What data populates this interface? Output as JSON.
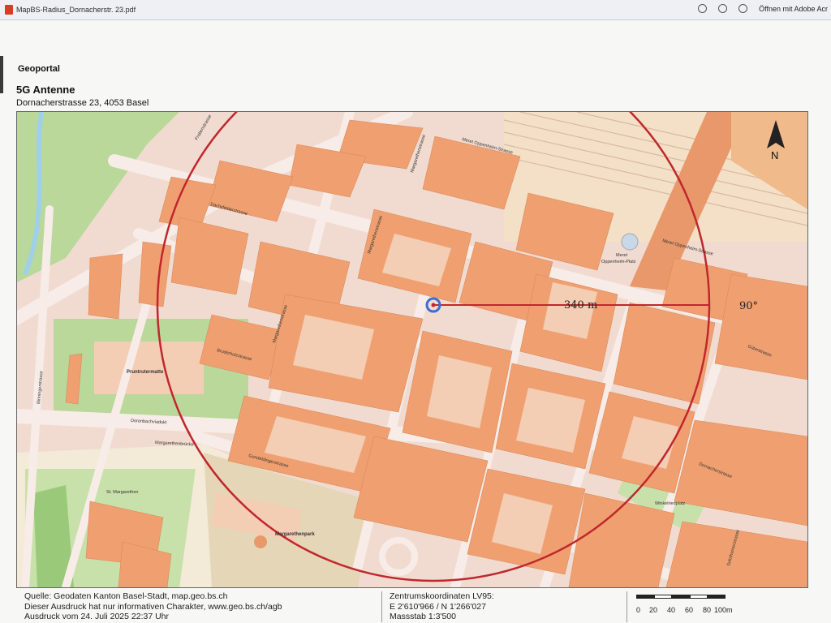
{
  "viewer": {
    "filename": "MapBS-Radius_Dornacherstr. 23.pdf",
    "open_with": "Öffnen mit Adobe Acr"
  },
  "header": {
    "brand": "Geoportal",
    "title": "5G Antenne",
    "address": "Dornacherstrasse 23, 4053 Basel"
  },
  "map": {
    "radius_label": "340 m",
    "angle_label": "90°",
    "north_label": "N",
    "places": {
      "pruntruter": "Pruntrutermatte",
      "margarethenpark": "Margarethenpark",
      "st_margarethen": "St. Margarethen",
      "opp_platz_1": "Meret",
      "opp_platz_2": "Oppenheim-Platz",
      "winkelriedplatz": "Winkelriedplatz"
    },
    "streets": {
      "margarethenstrasse_a": "Margarethenstrasse",
      "margarethenstrasse_b": "Margarethenstrasse",
      "margarethenstrasse_c": "Margarethenstrasse",
      "meret_opp_a": "Meret Oppenheim-Strasse",
      "meret_opp_b": "Meret Oppenheim-Strasse",
      "dornacherstrasse": "Dornacherstrasse",
      "gueterstrasse": "Güterstrasse",
      "gundeldingerstrasse": "Gundeldingerstrasse",
      "dorenbachviadukt": "Dorenbachviadukt",
      "margarethenbruecke": "Margarethenbrücke",
      "binningerstrasse": "Binningerstrasse",
      "bruderholzstrasse": "Bruderholzstrasse",
      "dachsfelderstrasse": "Dachsfelderstrasse",
      "solothurnerstrasse": "Solothurnerstrasse",
      "frobenstrasse": "Frobenstrasse"
    },
    "colors": {
      "radius_circle": "#c0272d",
      "center_marker": "#3a6fd8",
      "building": "#f0a070",
      "block_light": "#f3cdb4",
      "green": "#b9d89a",
      "road": "#f4e2dc"
    }
  },
  "footer": {
    "source_1": "Quelle: Geodaten Kanton Basel-Stadt, map.geo.bs.ch",
    "source_2": "Dieser Ausdruck hat nur informativen Charakter, www.geo.bs.ch/agb",
    "source_3": "Ausdruck vom 24. Juli 2025 22:37 Uhr",
    "coords_title": "Zentrumskoordinaten LV95:",
    "coords_value": "E 2'610'966 / N 1'266'027",
    "scale": "Massstab 1:3'500",
    "scalebar": [
      "0",
      "20",
      "40",
      "60",
      "80",
      "100m"
    ]
  }
}
